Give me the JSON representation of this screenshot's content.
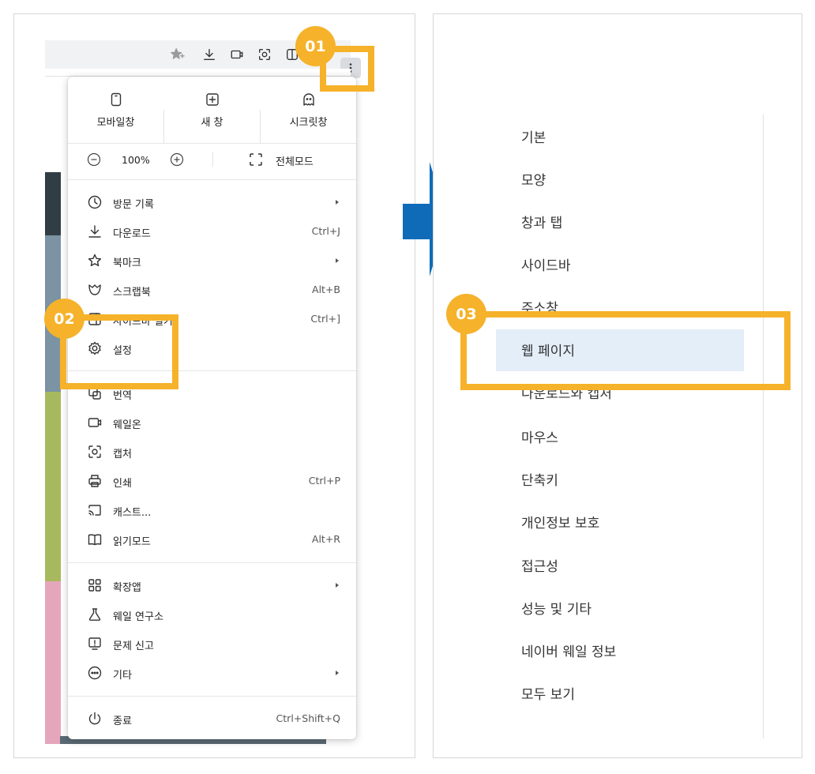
{
  "menu": {
    "quick": [
      {
        "label": "모바일창",
        "icon": "mobile-window-icon"
      },
      {
        "label": "새 창",
        "icon": "new-window-icon"
      },
      {
        "label": "시크릿창",
        "icon": "secret-window-icon"
      }
    ],
    "zoom": {
      "value": "100%",
      "fullscreen_label": "전체모드"
    },
    "items": [
      {
        "label": "방문 기록",
        "shortcut": "",
        "submenu": true
      },
      {
        "label": "다운로드",
        "shortcut": "Ctrl+J",
        "submenu": false
      },
      {
        "label": "북마크",
        "shortcut": "",
        "submenu": true
      },
      {
        "label": "스크랩북",
        "shortcut": "Alt+B",
        "submenu": false
      },
      {
        "label": "사이드바 열기",
        "shortcut": "Ctrl+]",
        "submenu": false
      },
      {
        "label": "설정",
        "shortcut": "",
        "submenu": false
      },
      {
        "label": "번역",
        "shortcut": "",
        "submenu": false
      },
      {
        "label": "웨일온",
        "shortcut": "",
        "submenu": false
      },
      {
        "label": "캡처",
        "shortcut": "",
        "submenu": false
      },
      {
        "label": "인쇄",
        "shortcut": "Ctrl+P",
        "submenu": false
      },
      {
        "label": "캐스트...",
        "shortcut": "",
        "submenu": false
      },
      {
        "label": "읽기모드",
        "shortcut": "Alt+R",
        "submenu": false
      },
      {
        "label": "확장앱",
        "shortcut": "",
        "submenu": true
      },
      {
        "label": "웨일 연구소",
        "shortcut": "",
        "submenu": false
      },
      {
        "label": "문제 신고",
        "shortcut": "",
        "submenu": false
      },
      {
        "label": "기타",
        "shortcut": "",
        "submenu": true
      },
      {
        "label": "종료",
        "shortcut": "Ctrl+Shift+Q",
        "submenu": false
      }
    ]
  },
  "settings_nav": {
    "items": [
      "기본",
      "모양",
      "창과 탭",
      "사이드바",
      "주소창",
      "웹 페이지",
      "다운로드와 캡처",
      "마우스",
      "단축키",
      "개인정보 보호",
      "접근성",
      "성능 및 기타",
      "네이버 웨일 정보",
      "모두 보기"
    ],
    "selected": "웹 페이지"
  },
  "callouts": {
    "step1": "01",
    "step2": "02",
    "step3": "03"
  },
  "colors": {
    "callout": "#f5b22a",
    "arrow": "#0f6bb8",
    "selected_bg": "#e3eef8"
  }
}
